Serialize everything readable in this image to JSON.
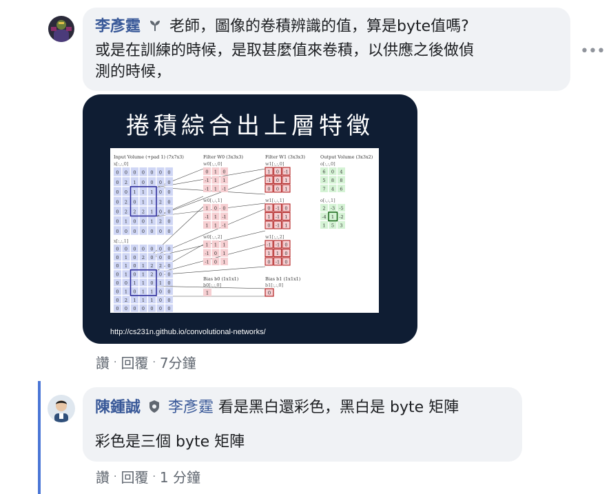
{
  "comments": [
    {
      "author": "李彥霆",
      "text_line1": "老師，圖像的卷積辨識的值，算是byte值嗎?",
      "text_line2": "或是在訓練的時候，是取甚麼值來卷積，以供應之後做偵",
      "text_line3": "測的時候，",
      "actions": {
        "like": "讚",
        "reply": "回覆",
        "time": "7分鐘"
      },
      "more": "•••"
    },
    {
      "author": "陳鍾誠",
      "mention": "李彥霆",
      "text_line1": "看是黑白還彩色，黑白是 byte 矩陣",
      "text_line2": "彩色是三個 byte 矩陣",
      "actions": {
        "like": "讚",
        "reply": "回覆",
        "time": "1 分鐘"
      }
    }
  ],
  "slide": {
    "title": "捲積綜合出上層特徵",
    "url": "http://cs231n.github.io/convolutional-networks/",
    "col_input": "Input Volume (+pad 1) (7x7x3)",
    "col_filter0": "Filter W0 (3x3x3)",
    "col_filter1": "Filter W1 (3x3x3)",
    "col_output": "Output Volume (3x3x2)",
    "x0": "x[:,:,0]",
    "x1": "x[:,:,1]",
    "w00": "w0[:,:,0]",
    "w01": "w0[:,:,1]",
    "w02": "w0[:,:,2]",
    "w10": "w1[:,:,0]",
    "w11": "w1[:,:,1]",
    "w12": "w1[:,:,2]",
    "o0": "o[:,:,0]",
    "o1": "o[:,:,1]",
    "bias0": "Bias b0 (1x1x1)",
    "bias0_label": "b0[:,:,0]",
    "bias0_val": "1",
    "bias1": "Bias b1 (1x1x1)",
    "bias1_label": "b1[:,:,0]",
    "bias1_val": "0",
    "x0_grid": [
      [
        "0",
        "0",
        "0",
        "0",
        "0",
        "0",
        "0"
      ],
      [
        "0",
        "2",
        "1",
        "0",
        "0",
        "0",
        "0"
      ],
      [
        "0",
        "0",
        "1",
        "1",
        "1",
        "0",
        "0"
      ],
      [
        "0",
        "2",
        "0",
        "1",
        "1",
        "2",
        "0"
      ],
      [
        "0",
        "2",
        "2",
        "2",
        "1",
        "0",
        "0"
      ],
      [
        "0",
        "1",
        "0",
        "0",
        "1",
        "2",
        "0"
      ],
      [
        "0",
        "0",
        "0",
        "0",
        "0",
        "0",
        "0"
      ]
    ],
    "x1_grid": [
      [
        "0",
        "0",
        "0",
        "0",
        "0",
        "0",
        "0"
      ],
      [
        "0",
        "1",
        "0",
        "2",
        "0",
        "0",
        "0"
      ],
      [
        "0",
        "1",
        "0",
        "1",
        "2",
        "2",
        "0"
      ],
      [
        "0",
        "1",
        "0",
        "1",
        "2",
        "0",
        "0"
      ],
      [
        "0",
        "0",
        "1",
        "1",
        "0",
        "1",
        "0"
      ],
      [
        "0",
        "1",
        "0",
        "1",
        "1",
        "0",
        "0"
      ],
      [
        "0",
        "2",
        "1",
        "1",
        "1",
        "0",
        "0"
      ],
      [
        "0",
        "0",
        "0",
        "0",
        "0",
        "0",
        "0"
      ]
    ],
    "w00_grid": [
      [
        "0",
        "1",
        "0"
      ],
      [
        "-1",
        "1",
        "1"
      ],
      [
        "-1",
        "1",
        "-1"
      ]
    ],
    "w01_grid": [
      [
        "1",
        "0",
        "0"
      ],
      [
        "-1",
        "1",
        "-1"
      ],
      [
        "1",
        "1",
        "-1"
      ]
    ],
    "w02_grid": [
      [
        "1",
        "1",
        "1"
      ],
      [
        "-1",
        "0",
        "1"
      ],
      [
        "-1",
        "0",
        "1"
      ]
    ],
    "w10_grid": [
      [
        "1",
        "0",
        "-1"
      ],
      [
        "-1",
        "0",
        "1"
      ],
      [
        "0",
        "0",
        "1"
      ]
    ],
    "w11_grid": [
      [
        "0",
        "-1",
        "0"
      ],
      [
        "1",
        "-1",
        "1"
      ],
      [
        "0",
        "-1",
        "1"
      ]
    ],
    "w12_grid": [
      [
        "-1",
        "-1",
        "0"
      ],
      [
        "1",
        "1",
        "0"
      ],
      [
        "0",
        "-1",
        "0"
      ]
    ],
    "o0_grid": [
      [
        "6",
        "0",
        "4"
      ],
      [
        "5",
        "8",
        "8"
      ],
      [
        "7",
        "4",
        "6"
      ]
    ],
    "o1_grid": [
      [
        "2",
        "-3",
        "-5"
      ],
      [
        "-4",
        "1",
        "-2"
      ],
      [
        "1",
        "5",
        "3"
      ]
    ]
  }
}
